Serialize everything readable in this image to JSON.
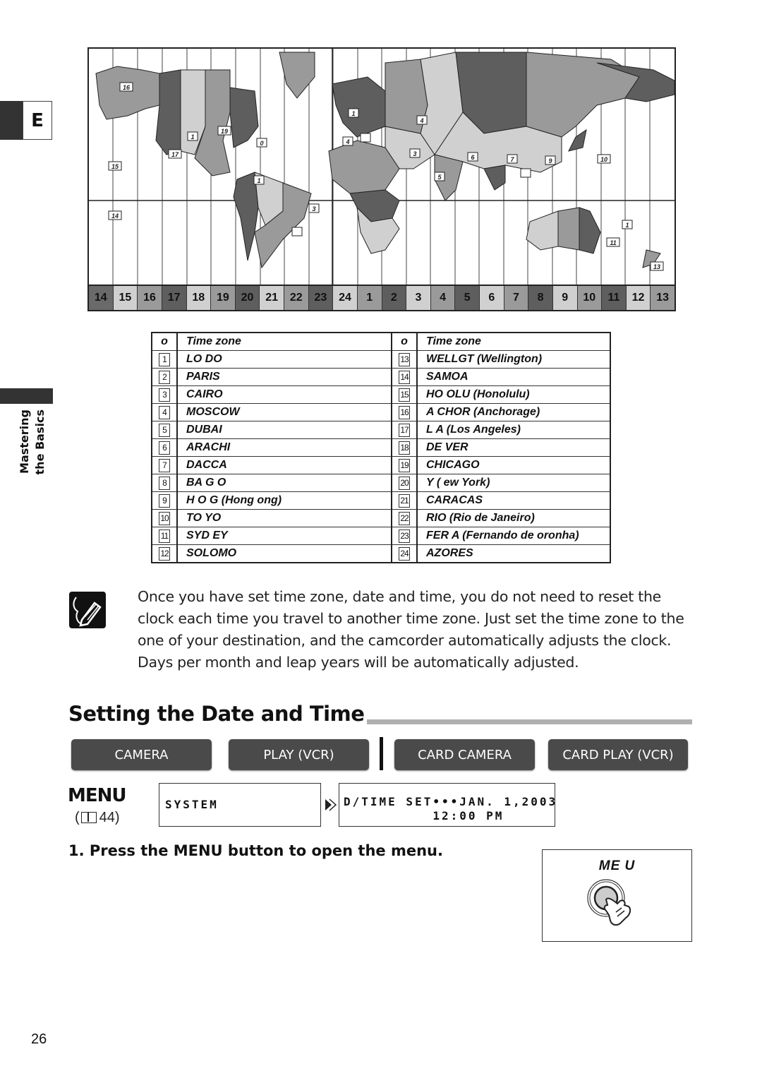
{
  "side": {
    "language_tab": "E",
    "section_line1": "Mastering",
    "section_line2": "the Basics"
  },
  "map": {
    "icon": "world-time-zone-map",
    "zone_strip": [
      "14",
      "15",
      "16",
      "17",
      "18",
      "19",
      "20",
      "21",
      "22",
      "23",
      "24",
      "1",
      "2",
      "3",
      "4",
      "5",
      "6",
      "7",
      "8",
      "9",
      "10",
      "11",
      "12",
      "13"
    ],
    "zone_shades": [
      "#6a6a6a",
      "#d0d0d0",
      "#9a9a9a",
      "#5e5e5e",
      "#d0d0d0",
      "#9a9a9a",
      "#5e5e5e",
      "#d0d0d0",
      "#9a9a9a",
      "#5e5e5e",
      "#d0d0d0",
      "#9a9a9a",
      "#5e5e5e",
      "#d0d0d0",
      "#9a9a9a",
      "#5e5e5e",
      "#d0d0d0",
      "#9a9a9a",
      "#5e5e5e",
      "#d0d0d0",
      "#9a9a9a",
      "#5e5e5e",
      "#d0d0d0",
      "#9a9a9a"
    ],
    "city_markers": [
      "16",
      "1",
      "19",
      "17",
      "15",
      "0",
      "1",
      "14",
      "3",
      "1",
      "4",
      "3",
      "4",
      "6",
      "7",
      "9",
      "10",
      "5",
      "1",
      "11",
      "13"
    ]
  },
  "table": {
    "col_no": "o",
    "col_zone": "Time zone",
    "left": [
      {
        "no": "1",
        "zone": "LO DO"
      },
      {
        "no": "2",
        "zone": "PARIS"
      },
      {
        "no": "3",
        "zone": "CAIRO"
      },
      {
        "no": "4",
        "zone": "MOSCOW"
      },
      {
        "no": "5",
        "zone": "DUBAI"
      },
      {
        "no": "6",
        "zone": " ARACHI"
      },
      {
        "no": "7",
        "zone": "DACCA"
      },
      {
        "no": "8",
        "zone": "BA G O"
      },
      {
        "no": "9",
        "zone": "H   O G (Hong  ong)"
      },
      {
        "no": "10",
        "zone": "TO YO"
      },
      {
        "no": "11",
        "zone": "SYD EY"
      },
      {
        "no": "12",
        "zone": "SOLOMO"
      }
    ],
    "right": [
      {
        "no": "13",
        "zone": "WELLGT  (Wellington)"
      },
      {
        "no": "14",
        "zone": "SAMOA"
      },
      {
        "no": "15",
        "zone": "HO OLU  (Honolulu)"
      },
      {
        "no": "16",
        "zone": "A CHOR  (Anchorage)"
      },
      {
        "no": "17",
        "zone": "L A  (Los Angeles)"
      },
      {
        "no": "18",
        "zone": "DE VER"
      },
      {
        "no": "19",
        "zone": "CHICAGO"
      },
      {
        "no": "20",
        "zone": "  Y  ( ew York)"
      },
      {
        "no": "21",
        "zone": "CARACAS"
      },
      {
        "no": "22",
        "zone": "RIO (Rio de Janeiro)"
      },
      {
        "no": "23",
        "zone": "FER A   (Fernando de  oronha)"
      },
      {
        "no": "24",
        "zone": "AZORES"
      }
    ]
  },
  "note": {
    "icon": "pencil-note-icon",
    "text": "Once you have set time zone, date and time, you do not need to reset the clock each time you travel to another time zone. Just set the time zone to the one of your destination, and the camcorder automatically adjusts the clock. Days per month and leap years will be automatically adjusted."
  },
  "section": {
    "title": "Setting the Date and Time"
  },
  "modes": {
    "camera": "CAMERA",
    "play_vcr": "PLAY (VCR)",
    "card_camera": "CARD CAMERA",
    "card_play_vcr": "CARD PLAY (VCR)"
  },
  "menu": {
    "logo": "MENU",
    "ref_open": "(",
    "ref_page": "44)",
    "lcd_system": "SYSTEM",
    "lcd_datetime_line1": "D/TIME SET•••JAN. 1,2003",
    "lcd_datetime_line2": "          12:00 PM"
  },
  "step1": {
    "text": "1. Press the MENU button to open the menu.",
    "illustration_label": "ME U"
  },
  "page_number": "26"
}
